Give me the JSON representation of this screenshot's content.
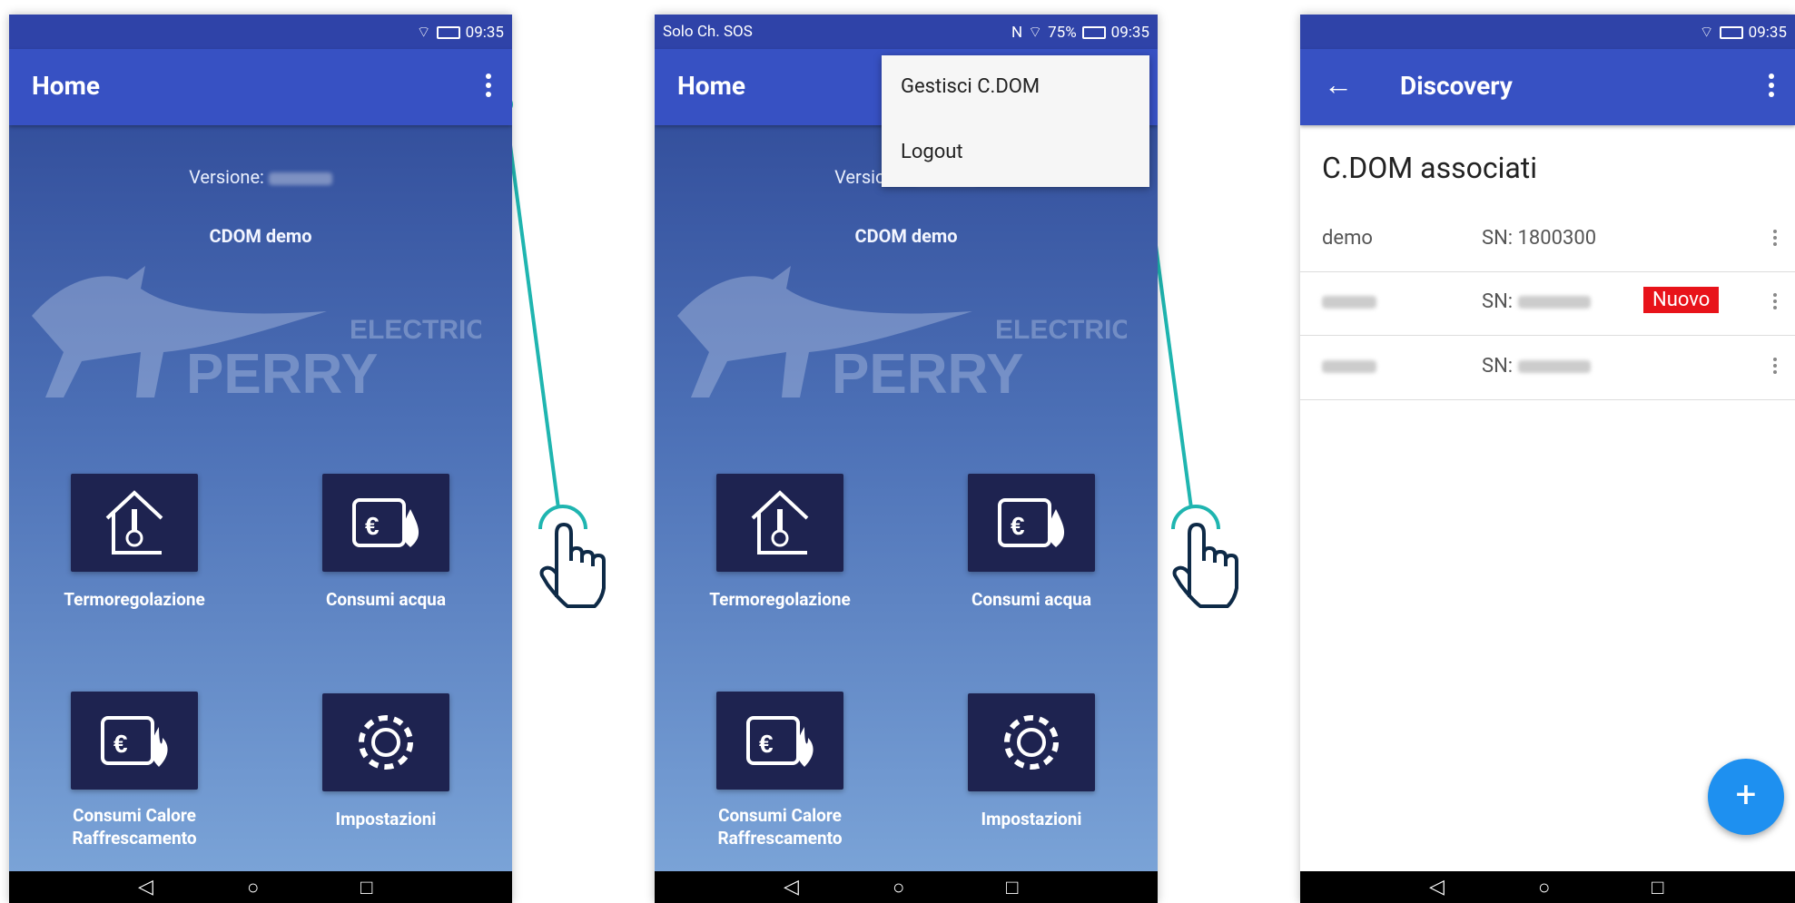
{
  "status": {
    "time": "09:35",
    "carrier": "Solo Ch. SOS",
    "battery": "75%"
  },
  "home": {
    "title": "Home",
    "version_label": "Versione:",
    "device_name": "CDOM demo",
    "logo_text_1": "ELECTRIC",
    "logo_text_2": "PERRY",
    "tiles": [
      {
        "label": "Termoregolazione"
      },
      {
        "label": "Consumi acqua"
      },
      {
        "label": "Consumi Calore Raffrescamento"
      },
      {
        "label": "Impostazioni"
      }
    ]
  },
  "menu": {
    "items": [
      "Gestisci C.DOM",
      "Logout"
    ]
  },
  "discovery": {
    "title": "Discovery",
    "section_title": "C.DOM associati",
    "rows": [
      {
        "name": "demo",
        "sn": "SN: 1800300",
        "badge": ""
      },
      {
        "name": "",
        "sn": "SN:",
        "badge": "Nuovo"
      },
      {
        "name": "",
        "sn": "SN:",
        "badge": ""
      }
    ],
    "fab": "+"
  },
  "colors": {
    "appbar": "#3751c3",
    "accent": "#1e90f0",
    "pointer": "#1fb5b0",
    "badge": "#e8131a"
  }
}
